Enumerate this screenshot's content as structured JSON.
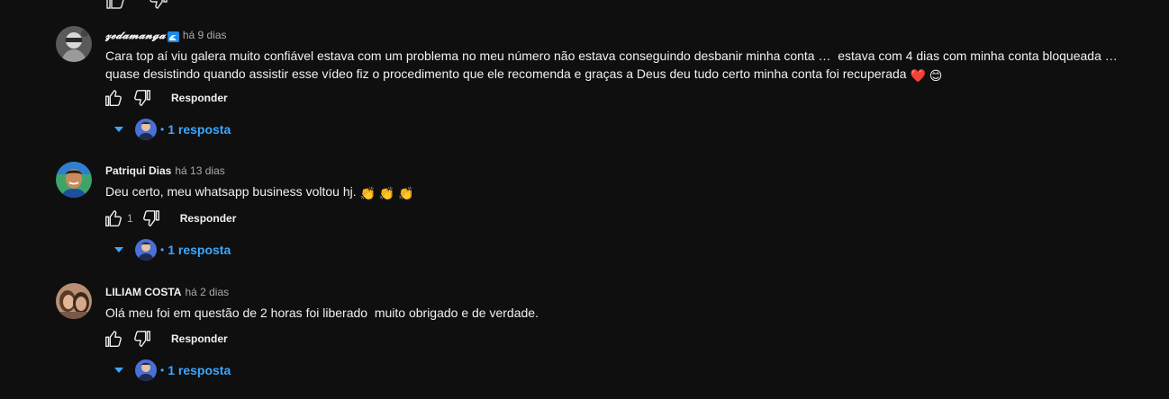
{
  "comments": [
    {
      "author": "𝔃𝓮𝓭𝓪𝓶𝓪𝓷𝓰𝓪",
      "badge_icon": "wave-badge-icon",
      "time": "há 9 dias",
      "text": "Cara top aí viu galera muito confiável estava com um problema no meu número não estava conseguindo desbanir minha conta …  estava com 4 dias com minha conta bloqueada … quase desistindo quando assistir esse vídeo fiz o procedimento que ele recomenda e graças a Deus deu tudo certo minha conta foi recuperada",
      "emojis": "❤️ 😊",
      "likes": "",
      "reply_label": "Responder",
      "replies_label": "1 resposta"
    },
    {
      "author": "Patriqui Dias",
      "time": "há 13 dias",
      "text": "Deu certo, meu whatsapp business voltou hj.",
      "emojis": "👏 👏 👏",
      "likes": "1",
      "reply_label": "Responder",
      "replies_label": "1 resposta"
    },
    {
      "author": "LILIAM COSTA",
      "time": "há 2 dias",
      "text": "Olá meu foi em questão de 2 horas foi liberado  muito obrigado e de verdade.",
      "emojis": "",
      "likes": "",
      "reply_label": "Responder",
      "replies_label": "1 resposta"
    }
  ],
  "colors": {
    "background": "#0f0f0f",
    "text": "#f1f1f1",
    "secondary": "#aaaaaa",
    "link": "#3ea6ff"
  }
}
